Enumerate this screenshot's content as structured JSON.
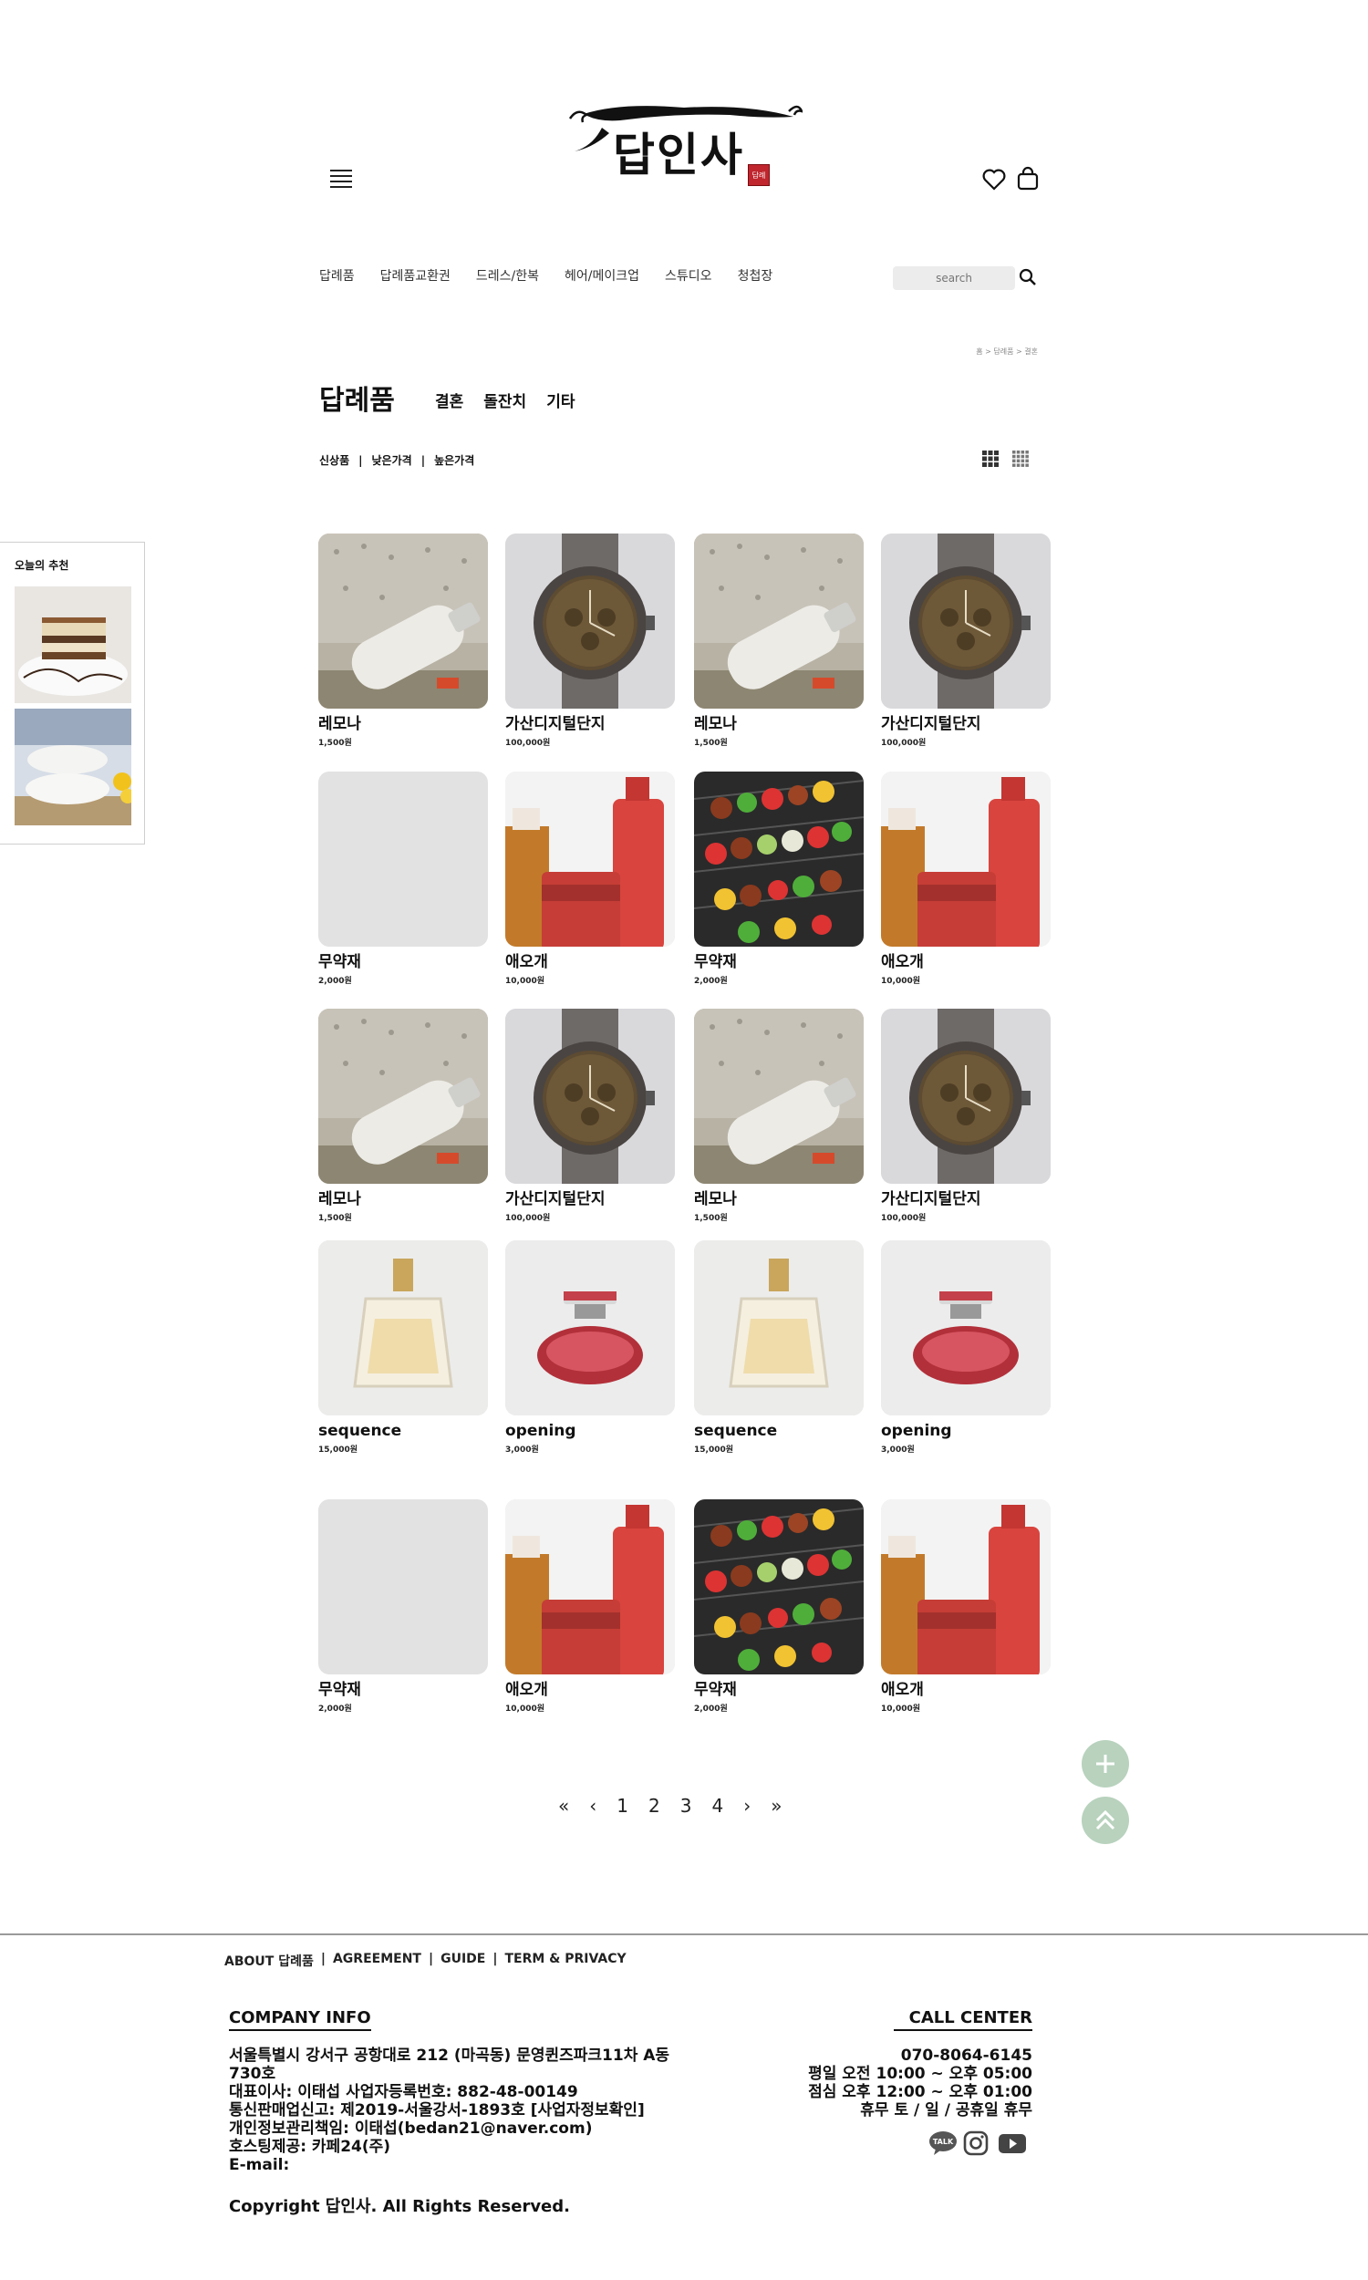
{
  "brand": {
    "logo_text": "답인사",
    "seal_text": "답례"
  },
  "nav": {
    "items": [
      "답례품",
      "답례품교환권",
      "드레스/한복",
      "헤어/메이크업",
      "스튜디오",
      "청첩장"
    ],
    "search_placeholder": "search"
  },
  "breadcrumb": "홈 > 답례품 > 결혼",
  "page": {
    "title": "답례품",
    "categories": [
      "결혼",
      "돌잔치",
      "기타"
    ],
    "sort_options": [
      "신상품",
      "낮은가격",
      "높은가격"
    ],
    "sort_separator": "|"
  },
  "recommend": {
    "title": "오늘의 추천"
  },
  "products": [
    {
      "name": "레모나",
      "price": "1,500원",
      "image": "pouch-bottle"
    },
    {
      "name": "가산디지털단지",
      "price": "100,000원",
      "image": "watch"
    },
    {
      "name": "레모나",
      "price": "1,500원",
      "image": "pouch-bottle"
    },
    {
      "name": "가산디지털단지",
      "price": "100,000원",
      "image": "watch"
    },
    {
      "name": "무약재",
      "price": "2,000원",
      "image": "blank"
    },
    {
      "name": "애오개",
      "price": "10,000원",
      "image": "cosmetics"
    },
    {
      "name": "무약재",
      "price": "2,000원",
      "image": "skewers"
    },
    {
      "name": "애오개",
      "price": "10,000원",
      "image": "cosmetics"
    },
    {
      "name": "레모나",
      "price": "1,500원",
      "image": "pouch-bottle"
    },
    {
      "name": "가산디지털단지",
      "price": "100,000원",
      "image": "watch"
    },
    {
      "name": "레모나",
      "price": "1,500원",
      "image": "pouch-bottle"
    },
    {
      "name": "가산디지털단지",
      "price": "100,000원",
      "image": "watch"
    },
    {
      "name": "sequence",
      "price": "15,000원",
      "image": "perfume-gold"
    },
    {
      "name": "opening",
      "price": "3,000원",
      "image": "perfume-red"
    },
    {
      "name": "sequence",
      "price": "15,000원",
      "image": "perfume-gold"
    },
    {
      "name": "opening",
      "price": "3,000원",
      "image": "perfume-red"
    },
    {
      "name": "무약재",
      "price": "2,000원",
      "image": "blank"
    },
    {
      "name": "애오개",
      "price": "10,000원",
      "image": "cosmetics"
    },
    {
      "name": "무약재",
      "price": "2,000원",
      "image": "skewers"
    },
    {
      "name": "애오개",
      "price": "10,000원",
      "image": "cosmetics"
    }
  ],
  "pagination": {
    "first": "«",
    "prev": "‹",
    "pages": [
      "1",
      "2",
      "3",
      "4"
    ],
    "next": "›",
    "last": "»"
  },
  "footer": {
    "links": [
      "ABOUT 답례품",
      "AGREEMENT",
      "GUIDE",
      "TERM & PRIVACY"
    ],
    "link_separator": "|",
    "company_title": "COMPANY INFO",
    "company_lines": [
      "서울특별시 강서구 공항대로 212 (마곡동) 문영퀸즈파크11차 A동",
      "730호",
      "대표이사: 이태섭    사업자등록번호: 882-48-00149",
      "통신판매업신고: 제2019-서울강서-1893호 [사업자정보확인]",
      "개인정보관리책임: 이태섭(bedan21@naver.com)",
      "호스팅제공: 카페24(주)",
      "E-mail:"
    ],
    "copyright": "Copyright 답인사. All Rights Reserved.",
    "call_title": "CALL CENTER",
    "call_lines": [
      "070-8064-6145",
      "평일 오전 10:00 ~ 오후 05:00",
      "점심  오후 12:00 ~ 오후 01:00",
      "휴무 토 / 일 / 공휴일 휴무"
    ],
    "social": [
      "kakaotalk-icon",
      "instagram-icon",
      "youtube-icon"
    ],
    "talk_label": "TALK"
  }
}
